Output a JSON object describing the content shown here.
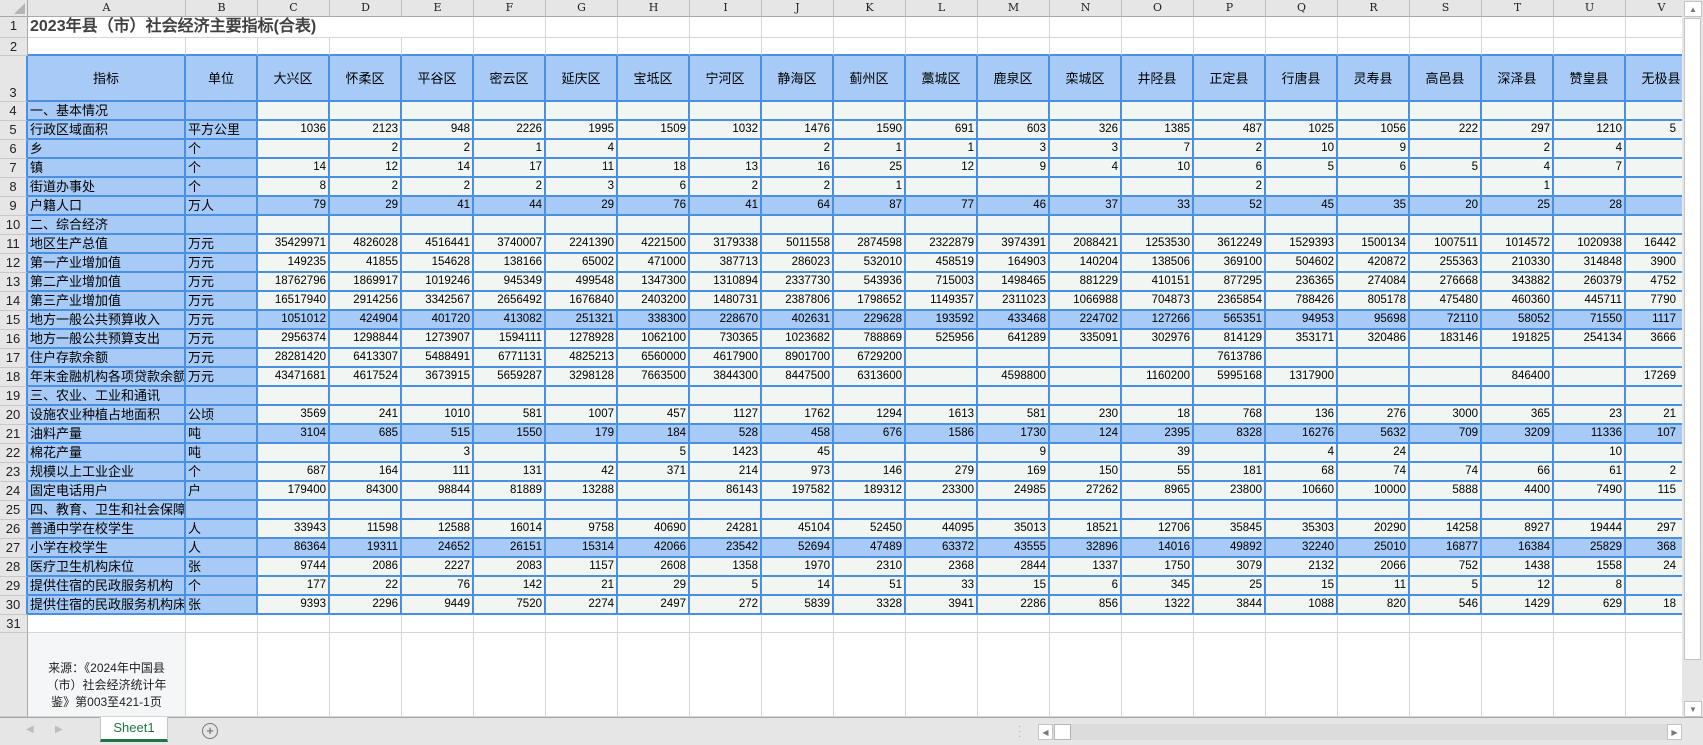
{
  "title": "2023年县（市）社会经济主要指标(合表)",
  "columns": [
    "A",
    "B",
    "C",
    "D",
    "E",
    "F",
    "G",
    "H",
    "I",
    "J",
    "K",
    "L",
    "M",
    "N",
    "O",
    "P",
    "Q",
    "R",
    "S",
    "T",
    "U",
    "V"
  ],
  "row_numbers": [
    "1",
    "2",
    "3",
    "4",
    "5",
    "6",
    "7",
    "8",
    "9",
    "10",
    "11",
    "12",
    "13",
    "14",
    "15",
    "16",
    "17",
    "18",
    "19",
    "20",
    "21",
    "22",
    "23",
    "24",
    "25",
    "26",
    "27",
    "28",
    "29",
    "30",
    "31"
  ],
  "header": {
    "indicator": "指标",
    "unit": "单位",
    "regions": [
      "大兴区",
      "怀柔区",
      "平谷区",
      "密云区",
      "延庆区",
      "宝坻区",
      "宁河区",
      "静海区",
      "蓟州区",
      "藁城区",
      "鹿泉区",
      "栾城区",
      "井陉县",
      "正定县",
      "行唐县",
      "灵寿县",
      "高邑县",
      "深泽县",
      "赞皇县",
      "无极县"
    ]
  },
  "rows": [
    {
      "label": "一、基本情况"
    },
    {
      "label": "行政区域面积",
      "unit": "平方公里",
      "values": [
        1036,
        2123,
        948,
        2226,
        1995,
        1509,
        1032,
        1476,
        1590,
        691,
        603,
        326,
        1385,
        487,
        1025,
        1056,
        222,
        297,
        1210,
        "5"
      ]
    },
    {
      "label": "乡",
      "unit": "个",
      "values": [
        null,
        2,
        2,
        1,
        4,
        null,
        null,
        2,
        1,
        1,
        3,
        3,
        7,
        2,
        10,
        9,
        null,
        2,
        4,
        null
      ]
    },
    {
      "label": "镇",
      "unit": "个",
      "values": [
        14,
        12,
        14,
        17,
        11,
        18,
        13,
        16,
        25,
        12,
        9,
        4,
        10,
        6,
        5,
        6,
        5,
        4,
        7,
        null
      ]
    },
    {
      "label": "街道办事处",
      "unit": "个",
      "values": [
        8,
        2,
        2,
        2,
        3,
        6,
        2,
        2,
        1,
        null,
        null,
        null,
        null,
        2,
        null,
        null,
        null,
        1,
        null,
        null
      ]
    },
    {
      "label": "户籍人口",
      "unit": "万人",
      "values": [
        79,
        29,
        41,
        44,
        29,
        76,
        41,
        64,
        87,
        77,
        46,
        37,
        33,
        52,
        45,
        35,
        20,
        25,
        28,
        null
      ]
    },
    {
      "label": "二、综合经济"
    },
    {
      "label": "地区生产总值",
      "unit": "万元",
      "values": [
        35429971,
        4826028,
        4516441,
        3740007,
        2241390,
        4221500,
        3179338,
        5011558,
        2874598,
        2322879,
        3974391,
        2088421,
        1253530,
        3612249,
        1529393,
        1500134,
        1007511,
        1014572,
        1020938,
        "16442"
      ]
    },
    {
      "label": "第一产业增加值",
      "unit": "万元",
      "values": [
        149235,
        41855,
        154628,
        138166,
        65002,
        471000,
        387713,
        286023,
        532010,
        458519,
        164903,
        140204,
        138506,
        369100,
        504602,
        420872,
        255363,
        210330,
        314848,
        "3900"
      ]
    },
    {
      "label": "第二产业增加值",
      "unit": "万元",
      "values": [
        18762796,
        1869917,
        1019246,
        945349,
        499548,
        1347300,
        1310894,
        2337730,
        543936,
        715003,
        1498465,
        881229,
        410151,
        877295,
        236365,
        274084,
        276668,
        343882,
        260379,
        "4752"
      ]
    },
    {
      "label": "第三产业增加值",
      "unit": "万元",
      "values": [
        16517940,
        2914256,
        3342567,
        2656492,
        1676840,
        2403200,
        1480731,
        2387806,
        1798652,
        1149357,
        2311023,
        1066988,
        704873,
        2365854,
        788426,
        805178,
        475480,
        460360,
        445711,
        "7790"
      ]
    },
    {
      "label": "地方一般公共预算收入",
      "unit": "万元",
      "values": [
        1051012,
        424904,
        401720,
        413082,
        251321,
        338300,
        228670,
        402631,
        229628,
        193592,
        433468,
        224702,
        127266,
        565351,
        94953,
        95698,
        72110,
        58052,
        71550,
        "1117"
      ]
    },
    {
      "label": "地方一般公共预算支出",
      "unit": "万元",
      "values": [
        2956374,
        1298844,
        1273907,
        1594111,
        1278928,
        1062100,
        730365,
        1023682,
        788869,
        525956,
        641289,
        335091,
        302976,
        814129,
        353171,
        320486,
        183146,
        191825,
        254134,
        "3666"
      ]
    },
    {
      "label": "住户存款余额",
      "unit": "万元",
      "values": [
        28281420,
        6413307,
        5488491,
        6771131,
        4825213,
        6560000,
        4617900,
        8901700,
        6729200,
        null,
        null,
        null,
        null,
        7613786,
        null,
        null,
        null,
        null,
        null,
        null
      ]
    },
    {
      "label": "年末金融机构各项贷款余额",
      "unit": "万元",
      "values": [
        43471681,
        4617524,
        3673915,
        5659287,
        3298128,
        7663500,
        3844300,
        8447500,
        6313600,
        null,
        4598800,
        null,
        1160200,
        5995168,
        1317900,
        null,
        null,
        846400,
        null,
        "17269"
      ]
    },
    {
      "label": "三、农业、工业和通讯"
    },
    {
      "label": "设施农业种植占地面积",
      "unit": "公顷",
      "values": [
        3569,
        241,
        1010,
        581,
        1007,
        457,
        1127,
        1762,
        1294,
        1613,
        581,
        230,
        18,
        768,
        136,
        276,
        3000,
        365,
        23,
        "21"
      ]
    },
    {
      "label": "油料产量",
      "unit": "吨",
      "values": [
        3104,
        685,
        515,
        1550,
        179,
        184,
        528,
        458,
        676,
        1586,
        1730,
        124,
        2395,
        8328,
        16276,
        5632,
        709,
        3209,
        11336,
        "107"
      ]
    },
    {
      "label": "棉花产量",
      "unit": "吨",
      "values": [
        null,
        null,
        3,
        null,
        null,
        5,
        1423,
        45,
        null,
        null,
        9,
        null,
        39,
        null,
        4,
        24,
        null,
        null,
        10,
        null
      ]
    },
    {
      "label": "规模以上工业企业",
      "unit": "个",
      "values": [
        687,
        164,
        111,
        131,
        42,
        371,
        214,
        973,
        146,
        279,
        169,
        150,
        55,
        181,
        68,
        74,
        74,
        66,
        61,
        "2"
      ]
    },
    {
      "label": "固定电话用户",
      "unit": "户",
      "values": [
        179400,
        84300,
        98844,
        81889,
        13288,
        null,
        86143,
        197582,
        189312,
        23300,
        24985,
        27262,
        8965,
        23800,
        10660,
        10000,
        5888,
        4400,
        7490,
        "115"
      ]
    },
    {
      "label": "四、教育、卫生和社会保障"
    },
    {
      "label": "普通中学在校学生",
      "unit": "人",
      "values": [
        33943,
        11598,
        12588,
        16014,
        9758,
        40690,
        24281,
        45104,
        52450,
        44095,
        35013,
        18521,
        12706,
        35845,
        35303,
        20290,
        14258,
        8927,
        19444,
        "297"
      ]
    },
    {
      "label": "小学在校学生",
      "unit": "人",
      "values": [
        86364,
        19311,
        24652,
        26151,
        15314,
        42066,
        23542,
        52694,
        47489,
        63372,
        43555,
        32896,
        14016,
        49892,
        32240,
        25010,
        16877,
        16384,
        25829,
        "368"
      ]
    },
    {
      "label": "医疗卫生机构床位",
      "unit": "张",
      "values": [
        9744,
        2086,
        2227,
        2083,
        1157,
        2608,
        1358,
        1970,
        2310,
        2368,
        2844,
        1337,
        1750,
        3079,
        2132,
        2066,
        752,
        1438,
        1558,
        "24"
      ]
    },
    {
      "label": "提供住宿的民政服务机构",
      "unit": "个",
      "values": [
        177,
        22,
        76,
        142,
        21,
        29,
        5,
        14,
        51,
        33,
        15,
        6,
        345,
        25,
        15,
        11,
        5,
        12,
        8,
        null
      ]
    },
    {
      "label": "提供住宿的民政服务机构床位",
      "unit": "张",
      "values": [
        9393,
        2296,
        9449,
        7520,
        2274,
        2497,
        272,
        5839,
        3328,
        3941,
        2286,
        856,
        1322,
        3844,
        1088,
        820,
        546,
        1429,
        629,
        "18"
      ]
    }
  ],
  "source": "来源：《2024年中国县（市）社会经济统计年鉴》第003至421-1页",
  "sheet_tab": "Sheet1",
  "colors": {
    "header_fill": "#a7cbf6",
    "border_blue": "#4a90e2",
    "cell_fill": "#f1f6f3",
    "tab_green": "#217346"
  }
}
